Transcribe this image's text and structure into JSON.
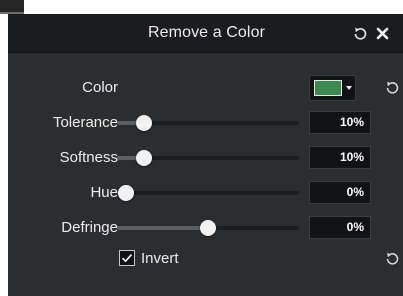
{
  "panel": {
    "title": "Remove a Color",
    "header_icons": [
      "reset-icon",
      "close-icon"
    ]
  },
  "color": {
    "label": "Color",
    "swatch_color": "#3a8a52"
  },
  "sliders": [
    {
      "key": "tolerance",
      "label": "Tolerance",
      "value_text": "10%",
      "fraction": 0.15
    },
    {
      "key": "softness",
      "label": "Softness",
      "value_text": "10%",
      "fraction": 0.15
    },
    {
      "key": "hue",
      "label": "Hue",
      "value_text": "0%",
      "fraction": 0.05
    },
    {
      "key": "defringe",
      "label": "Defringe",
      "value_text": "0%",
      "fraction": 0.5
    }
  ],
  "invert": {
    "label": "Invert",
    "checked": true
  },
  "colors": {
    "panel_bg": "#2b2d2f",
    "header_bg": "#1b1c1e",
    "text": "#ececec",
    "field_bg": "#111214"
  }
}
